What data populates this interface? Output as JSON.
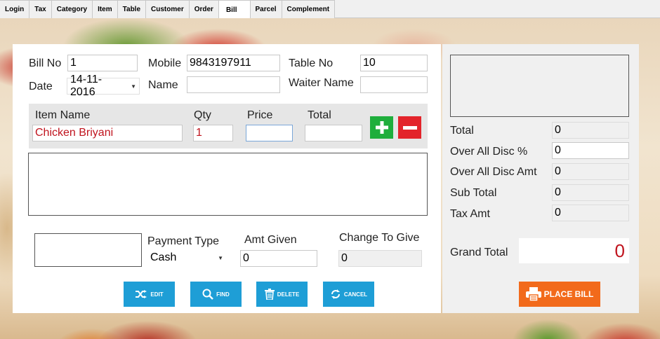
{
  "tabs": [
    "Login",
    "Tax",
    "Category",
    "Item",
    "Table",
    "Customer",
    "Order",
    "Bill",
    "Parcel",
    "Complement"
  ],
  "active_tab": "Bill",
  "bill": {
    "bill_no_label": "Bill No",
    "bill_no": "1",
    "mobile_label": "Mobile",
    "mobile": "9843197911",
    "table_no_label": "Table No",
    "table_no": "10",
    "date_label": "Date",
    "date": "14-11-2016",
    "name_label": "Name",
    "name": "",
    "waiter_label": "Waiter Name",
    "waiter": ""
  },
  "item_entry": {
    "item_name_label": "Item Name",
    "item_name": "Chicken Briyani",
    "qty_label": "Qty",
    "qty": "1",
    "price_label": "Price",
    "price": "",
    "total_label": "Total",
    "total": ""
  },
  "payment": {
    "type_label": "Payment Type",
    "type": "Cash",
    "amt_given_label": "Amt Given",
    "amt_given": "0",
    "change_label": "Change To Give",
    "change": "0"
  },
  "actions": {
    "edit": "EDIT",
    "find": "FIND",
    "delete": "DELETE",
    "cancel": "CANCEL"
  },
  "summary": {
    "total_label": "Total",
    "total": "0",
    "disc_pct_label": "Over All Disc %",
    "disc_pct": "0",
    "disc_amt_label": "Over All Disc Amt",
    "disc_amt": "0",
    "sub_total_label": "Sub Total",
    "sub_total": "0",
    "tax_label": "Tax Amt",
    "tax": "0",
    "grand_label": "Grand Total",
    "grand": "0",
    "place_bill": "PLACE BILL"
  },
  "colors": {
    "plus": "#1fae3c",
    "minus": "#e3242b",
    "action": "#1e9ed6",
    "place_bill": "#f26a1b",
    "grand_total": "#c0141e"
  }
}
